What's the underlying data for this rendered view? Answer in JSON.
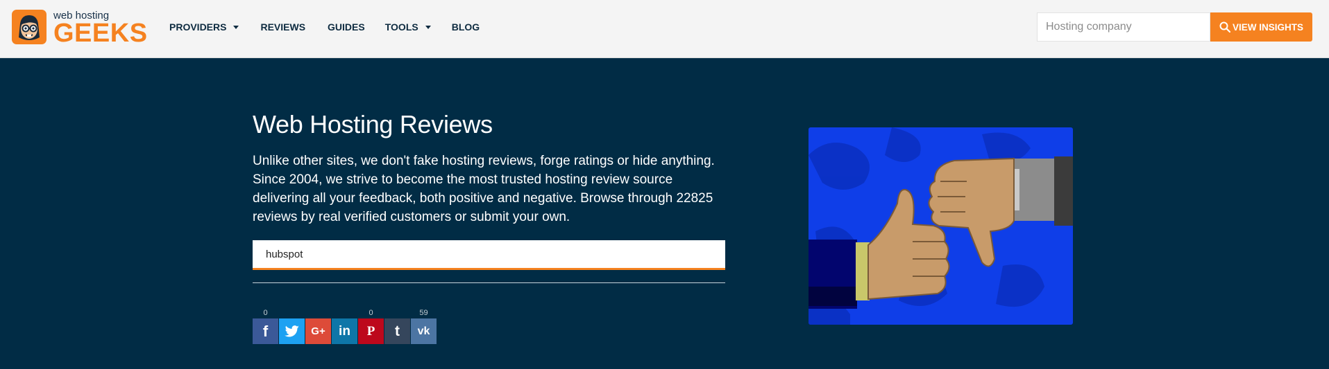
{
  "header": {
    "logo_small": "web hosting",
    "logo_big": "GEEKS",
    "nav": [
      {
        "label": "PROVIDERS",
        "dropdown": true
      },
      {
        "label": "REVIEWS",
        "dropdown": false
      },
      {
        "label": "GUIDES",
        "dropdown": false
      },
      {
        "label": "TOOLS",
        "dropdown": true
      },
      {
        "label": "BLOG",
        "dropdown": false
      }
    ],
    "search_placeholder": "Hosting company",
    "insights_label": "VIEW INSIGHTS"
  },
  "hero": {
    "title": "Web Hosting Reviews",
    "description": "Unlike other sites, we don't fake hosting reviews, forge ratings or hide anything. Since 2004, we strive to become the most trusted hosting review source delivering all your feedback, both positive and negative. Browse through 22825 reviews by real verified customers or submit your own.",
    "search_value": "hubspot"
  },
  "share": [
    {
      "name": "facebook",
      "glyph": "f",
      "count": "0",
      "color": "#3b5998"
    },
    {
      "name": "twitter",
      "glyph": "t",
      "count": "",
      "color": "#1da1f2"
    },
    {
      "name": "google-plus",
      "glyph": "G+",
      "count": "",
      "color": "#dd4b39"
    },
    {
      "name": "linkedin",
      "glyph": "in",
      "count": "",
      "color": "#0e76a8"
    },
    {
      "name": "pinterest",
      "glyph": "P",
      "count": "0",
      "color": "#bd081c"
    },
    {
      "name": "tumblr",
      "glyph": "t",
      "count": "",
      "color": "#35465c"
    },
    {
      "name": "vk",
      "glyph": "vk",
      "count": "59",
      "color": "#4c75a3"
    }
  ],
  "colors": {
    "accent": "#f58220",
    "hero_bg": "#012c45",
    "nav_text": "#0e2b40"
  }
}
